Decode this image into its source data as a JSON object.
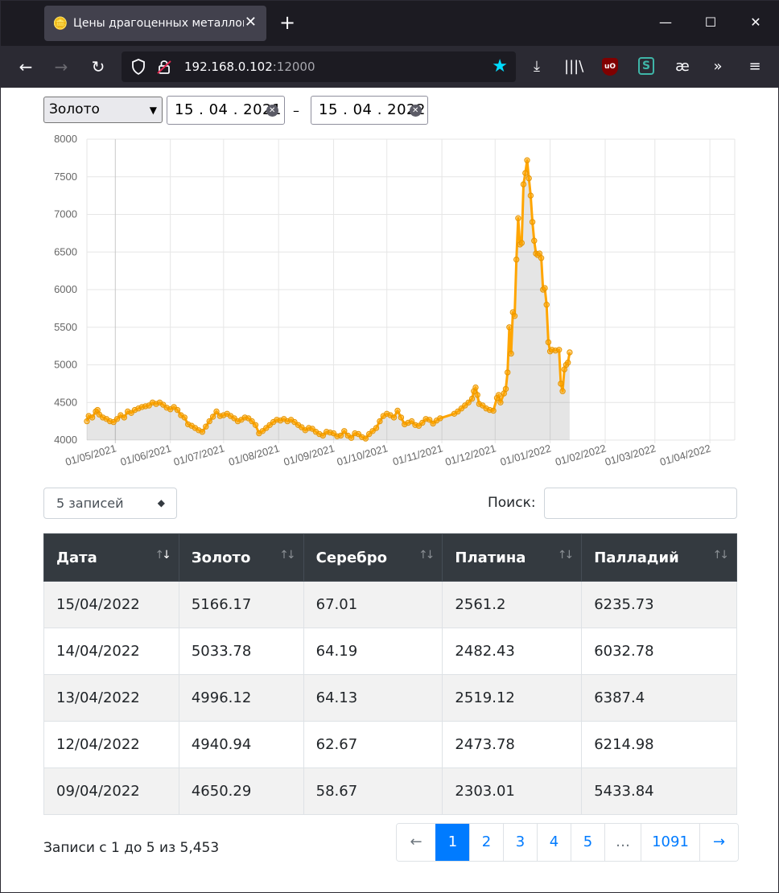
{
  "browser": {
    "tab_title": "Цены драгоценных металлов",
    "url_host": "192.168.0.102",
    "url_port": ":12000"
  },
  "filters": {
    "metal": "Золото",
    "date_from": "15 . 04 . 2021",
    "date_sep": "–",
    "date_to": "15 . 04 . 2022"
  },
  "chart_data": {
    "type": "area",
    "series": [
      {
        "name": "Золото",
        "color": "#ffa500"
      }
    ],
    "y_ticks": [
      "8000",
      "7500",
      "7000",
      "6500",
      "6000",
      "5500",
      "5000",
      "4500",
      "4000"
    ],
    "ylim": [
      4000,
      8000
    ],
    "x_ticks": [
      "01/05/2021",
      "01/06/2021",
      "01/07/2021",
      "01/08/2021",
      "01/09/2021",
      "01/10/2021",
      "01/11/2021",
      "01/12/2021",
      "01/01/2022",
      "01/02/2022",
      "01/03/2022",
      "01/04/2022"
    ],
    "x_tick_days": [
      16,
      47,
      77,
      108,
      139,
      169,
      200,
      230,
      261,
      292,
      320,
      351
    ],
    "xlim_days": [
      0,
      365
    ],
    "grid": true,
    "points": [
      [
        0,
        4250
      ],
      [
        1,
        4320
      ],
      [
        3,
        4300
      ],
      [
        5,
        4380
      ],
      [
        6,
        4400
      ],
      [
        7,
        4340
      ],
      [
        9,
        4300
      ],
      [
        11,
        4280
      ],
      [
        13,
        4250
      ],
      [
        15,
        4240
      ],
      [
        17,
        4280
      ],
      [
        19,
        4330
      ],
      [
        21,
        4300
      ],
      [
        23,
        4380
      ],
      [
        25,
        4360
      ],
      [
        27,
        4400
      ],
      [
        29,
        4420
      ],
      [
        31,
        4440
      ],
      [
        33,
        4450
      ],
      [
        35,
        4460
      ],
      [
        37,
        4500
      ],
      [
        39,
        4480
      ],
      [
        41,
        4500
      ],
      [
        43,
        4470
      ],
      [
        45,
        4430
      ],
      [
        47,
        4410
      ],
      [
        49,
        4440
      ],
      [
        51,
        4400
      ],
      [
        53,
        4330
      ],
      [
        55,
        4300
      ],
      [
        57,
        4210
      ],
      [
        59,
        4190
      ],
      [
        61,
        4160
      ],
      [
        63,
        4130
      ],
      [
        65,
        4110
      ],
      [
        67,
        4180
      ],
      [
        69,
        4250
      ],
      [
        71,
        4310
      ],
      [
        73,
        4380
      ],
      [
        75,
        4320
      ],
      [
        77,
        4330
      ],
      [
        79,
        4350
      ],
      [
        81,
        4320
      ],
      [
        83,
        4290
      ],
      [
        85,
        4250
      ],
      [
        87,
        4270
      ],
      [
        89,
        4300
      ],
      [
        91,
        4290
      ],
      [
        93,
        4250
      ],
      [
        95,
        4200
      ],
      [
        97,
        4090
      ],
      [
        99,
        4120
      ],
      [
        101,
        4160
      ],
      [
        103,
        4200
      ],
      [
        105,
        4240
      ],
      [
        107,
        4270
      ],
      [
        109,
        4260
      ],
      [
        111,
        4280
      ],
      [
        113,
        4250
      ],
      [
        115,
        4270
      ],
      [
        117,
        4240
      ],
      [
        119,
        4200
      ],
      [
        121,
        4170
      ],
      [
        123,
        4130
      ],
      [
        125,
        4160
      ],
      [
        127,
        4150
      ],
      [
        129,
        4110
      ],
      [
        131,
        4080
      ],
      [
        133,
        4060
      ],
      [
        135,
        4110
      ],
      [
        137,
        4100
      ],
      [
        139,
        4090
      ],
      [
        141,
        4050
      ],
      [
        143,
        4060
      ],
      [
        145,
        4120
      ],
      [
        147,
        4060
      ],
      [
        149,
        4030
      ],
      [
        151,
        4090
      ],
      [
        153,
        4080
      ],
      [
        155,
        4040
      ],
      [
        157,
        4020
      ],
      [
        159,
        4080
      ],
      [
        161,
        4120
      ],
      [
        163,
        4160
      ],
      [
        165,
        4250
      ],
      [
        167,
        4320
      ],
      [
        169,
        4350
      ],
      [
        171,
        4330
      ],
      [
        173,
        4300
      ],
      [
        175,
        4390
      ],
      [
        177,
        4300
      ],
      [
        179,
        4210
      ],
      [
        181,
        4230
      ],
      [
        183,
        4250
      ],
      [
        185,
        4200
      ],
      [
        187,
        4190
      ],
      [
        189,
        4230
      ],
      [
        191,
        4280
      ],
      [
        193,
        4270
      ],
      [
        195,
        4220
      ],
      [
        197,
        4260
      ],
      [
        199,
        4290
      ],
      [
        207,
        4350
      ],
      [
        209,
        4380
      ],
      [
        211,
        4420
      ],
      [
        213,
        4460
      ],
      [
        215,
        4500
      ],
      [
        217,
        4550
      ],
      [
        218,
        4650
      ],
      [
        219,
        4700
      ],
      [
        220,
        4600
      ],
      [
        221,
        4480
      ],
      [
        223,
        4460
      ],
      [
        225,
        4420
      ],
      [
        227,
        4400
      ],
      [
        229,
        4390
      ],
      [
        231,
        4560
      ],
      [
        232,
        4600
      ],
      [
        233,
        4500
      ],
      [
        235,
        4620
      ],
      [
        236,
        4680
      ],
      [
        237,
        4900
      ],
      [
        238,
        5500
      ],
      [
        239,
        5150
      ],
      [
        240,
        5700
      ],
      [
        241,
        5650
      ],
      [
        242,
        6400
      ],
      [
        243,
        6950
      ],
      [
        244,
        6600
      ],
      [
        245,
        6620
      ],
      [
        246,
        7400
      ],
      [
        247,
        7550
      ],
      [
        248,
        7720
      ],
      [
        249,
        7480
      ],
      [
        250,
        7250
      ],
      [
        251,
        6900
      ],
      [
        252,
        6650
      ],
      [
        253,
        6480
      ],
      [
        254,
        6460
      ],
      [
        255,
        6480
      ],
      [
        256,
        6420
      ],
      [
        257,
        6000
      ],
      [
        258,
        6020
      ],
      [
        259,
        5800
      ],
      [
        260,
        5300
      ],
      [
        261,
        5180
      ],
      [
        262,
        5200
      ],
      [
        264,
        5190
      ],
      [
        266,
        5200
      ],
      [
        267,
        4750
      ],
      [
        268,
        4650
      ],
      [
        269,
        4940
      ],
      [
        270,
        5000
      ],
      [
        271,
        5030
      ],
      [
        272,
        5166
      ]
    ]
  },
  "controls": {
    "length_label": "5 записей",
    "search_label": "Поиск:"
  },
  "table": {
    "headers": [
      "Дата",
      "Золото",
      "Серебро",
      "Платина",
      "Палладий"
    ],
    "rows": [
      [
        "15/04/2022",
        "5166.17",
        "67.01",
        "2561.2",
        "6235.73"
      ],
      [
        "14/04/2022",
        "5033.78",
        "64.19",
        "2482.43",
        "6032.78"
      ],
      [
        "13/04/2022",
        "4996.12",
        "64.13",
        "2519.12",
        "6387.4"
      ],
      [
        "12/04/2022",
        "4940.94",
        "62.67",
        "2473.78",
        "6214.98"
      ],
      [
        "09/04/2022",
        "4650.29",
        "58.67",
        "2303.01",
        "5433.84"
      ]
    ]
  },
  "footer": {
    "info": "Записи с 1 до 5 из 5,453",
    "pages": [
      "←",
      "1",
      "2",
      "3",
      "4",
      "5",
      "…",
      "1091",
      "→"
    ]
  }
}
